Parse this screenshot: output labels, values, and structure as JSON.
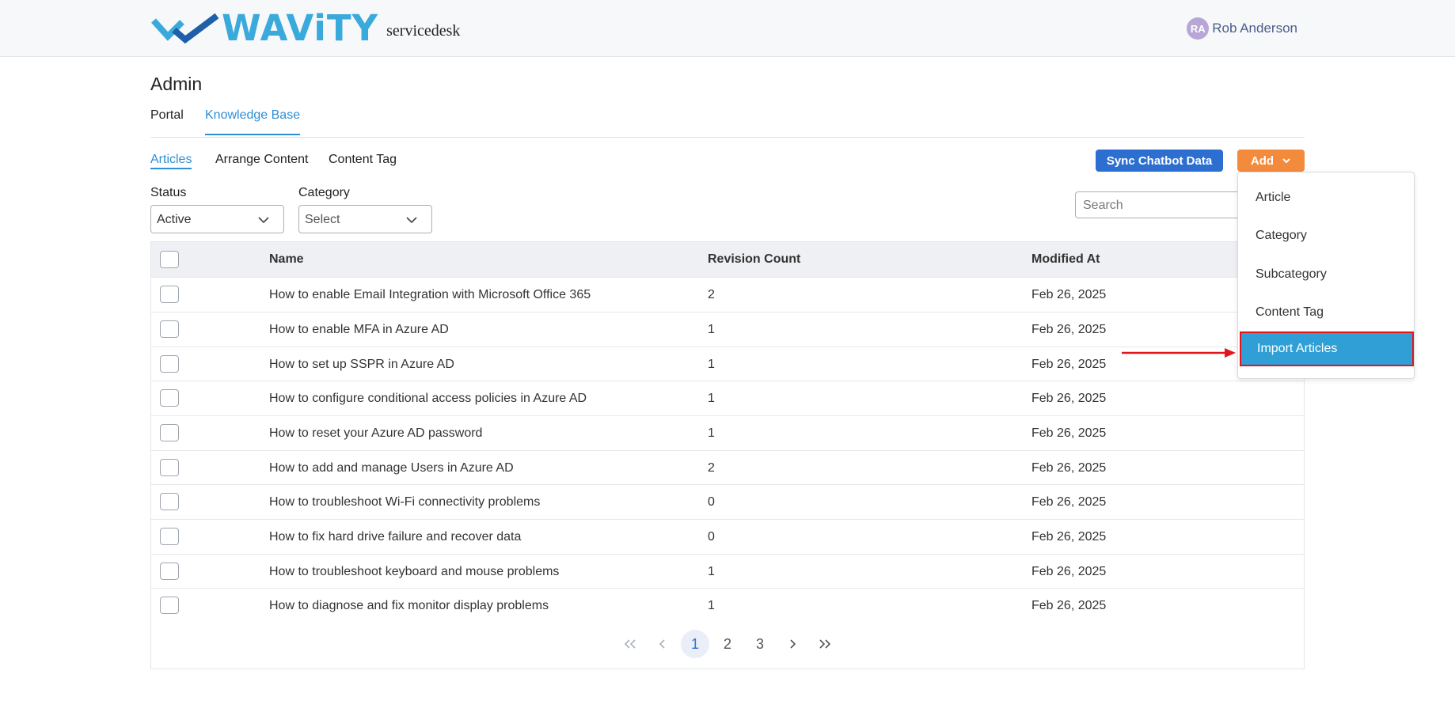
{
  "header": {
    "brand": "WAViTY",
    "product": "servicedesk",
    "user": {
      "initials": "RA",
      "name": "Rob Anderson"
    }
  },
  "page": {
    "title": "Admin"
  },
  "main_tabs": [
    {
      "label": "Portal",
      "active": false
    },
    {
      "label": "Knowledge Base",
      "active": true
    }
  ],
  "sub_tabs": [
    {
      "label": "Articles",
      "active": true
    },
    {
      "label": "Arrange Content",
      "active": false
    },
    {
      "label": "Content Tag",
      "active": false
    }
  ],
  "toolbar": {
    "sync_label": "Sync Chatbot Data",
    "add_label": "Add"
  },
  "filters": {
    "status": {
      "label": "Status",
      "value": "Active"
    },
    "category": {
      "label": "Category",
      "placeholder": "Select"
    }
  },
  "search": {
    "placeholder": "Search"
  },
  "table": {
    "columns": [
      "Name",
      "Revision Count",
      "Modified At"
    ],
    "rows": [
      {
        "name": "How to enable Email Integration with Microsoft Office 365",
        "revisions": "2",
        "modified": "Feb 26, 2025"
      },
      {
        "name": "How to enable MFA in Azure AD",
        "revisions": "1",
        "modified": "Feb 26, 2025"
      },
      {
        "name": "How to set up SSPR in Azure AD",
        "revisions": "1",
        "modified": "Feb 26, 2025"
      },
      {
        "name": "How to configure conditional access policies in Azure AD",
        "revisions": "1",
        "modified": "Feb 26, 2025"
      },
      {
        "name": "How to reset your Azure AD password",
        "revisions": "1",
        "modified": "Feb 26, 2025"
      },
      {
        "name": "How to add and manage Users in Azure AD",
        "revisions": "2",
        "modified": "Feb 26, 2025"
      },
      {
        "name": "How to troubleshoot Wi-Fi connectivity problems",
        "revisions": "0",
        "modified": "Feb 26, 2025"
      },
      {
        "name": "How to fix hard drive failure and recover data",
        "revisions": "0",
        "modified": "Feb 26, 2025"
      },
      {
        "name": "How to troubleshoot keyboard and mouse problems",
        "revisions": "1",
        "modified": "Feb 26, 2025"
      },
      {
        "name": "How to diagnose and fix monitor display problems",
        "revisions": "1",
        "modified": "Feb 26, 2025"
      }
    ]
  },
  "pagination": {
    "pages": [
      "1",
      "2",
      "3"
    ],
    "current": "1"
  },
  "add_menu": {
    "items": [
      {
        "label": "Article",
        "highlighted": false
      },
      {
        "label": "Category",
        "highlighted": false
      },
      {
        "label": "Subcategory",
        "highlighted": false
      },
      {
        "label": "Content Tag",
        "highlighted": false
      },
      {
        "label": "Import Articles",
        "highlighted": true
      }
    ]
  },
  "colors": {
    "accent": "#2d8fd5",
    "sync_button": "#2d6fd1",
    "add_button": "#f48a3c",
    "menu_highlight": "#2f9fd6",
    "callout_red": "#e0161b",
    "brand": "#3aa9dc"
  }
}
